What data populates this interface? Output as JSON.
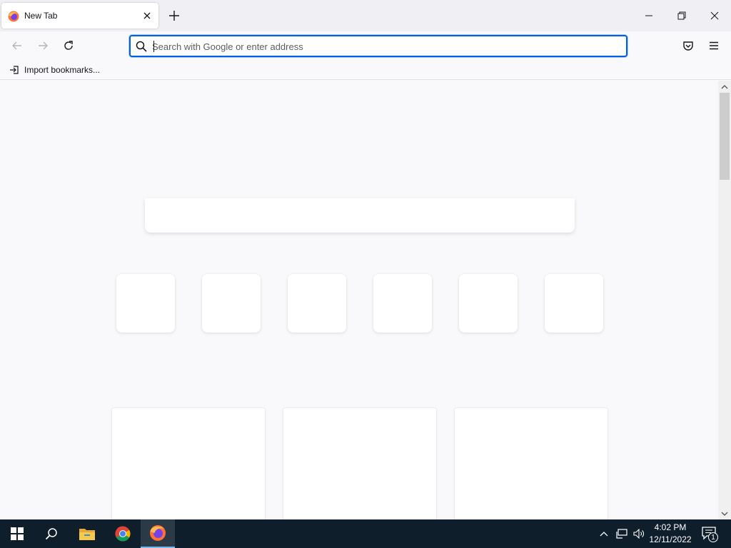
{
  "colors": {
    "accent": "#0061e0",
    "tabstrip_bg": "#f0f0f4",
    "content_bg": "#f9f9fb",
    "taskbar_bg": "#0f1e2b"
  },
  "tab": {
    "title": "New Tab",
    "favicon": "firefox-icon",
    "close_icon": "close-icon"
  },
  "tabstrip": {
    "new_tab_icon": "plus-icon"
  },
  "window_controls": {
    "minimize_icon": "minimize-icon",
    "restore_icon": "restore-icon",
    "close_icon": "close-icon"
  },
  "navbar": {
    "back_icon": "back-arrow-icon",
    "forward_icon": "forward-arrow-icon",
    "reload_icon": "reload-icon",
    "pocket_icon": "pocket-icon",
    "menu_icon": "hamburger-menu-icon"
  },
  "urlbar": {
    "placeholder": "Search with Google or enter address",
    "value": ""
  },
  "bookmarks": {
    "import_label": "Import bookmarks...",
    "import_icon": "import-icon"
  },
  "newtab": {
    "shortcut_tile_count_visible": 6,
    "story_card_count_visible": 3
  },
  "taskbar": {
    "apps": [
      "start-icon",
      "search-icon",
      "file-explorer-icon",
      "chrome-icon",
      "firefox-icon"
    ],
    "time": "4:02 PM",
    "date": "12/11/2022",
    "notification_count": "1"
  }
}
